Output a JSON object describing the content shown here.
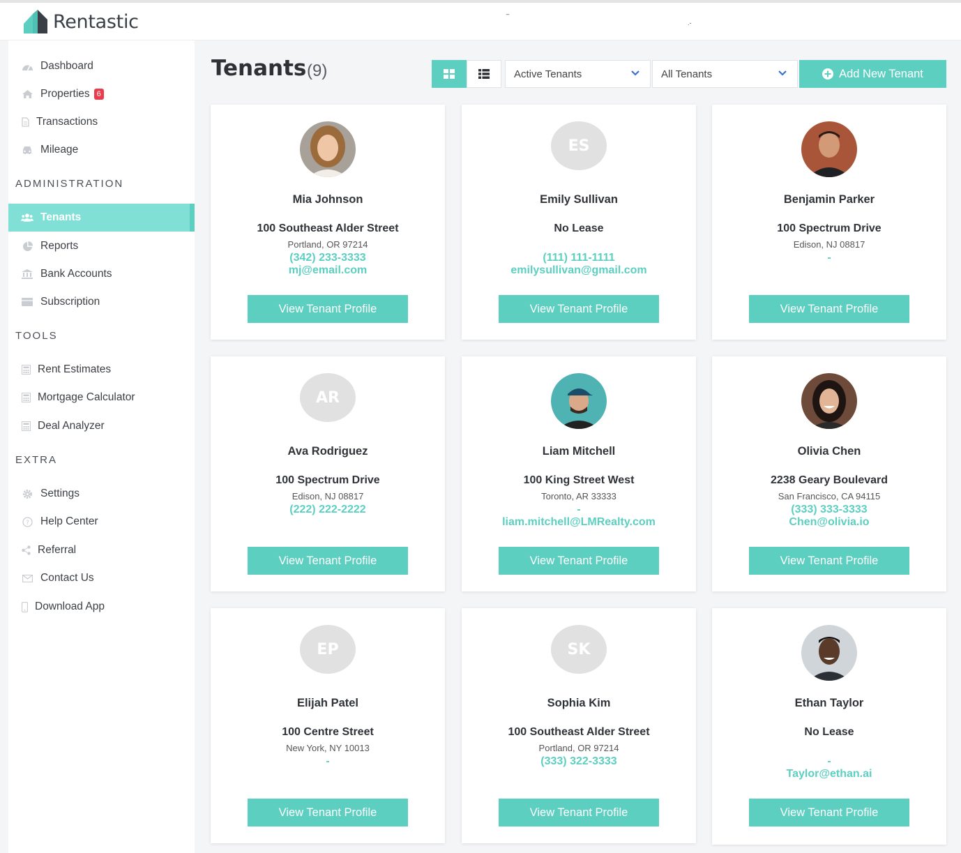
{
  "app": {
    "name": "Rentastic"
  },
  "sidebar": {
    "items": [
      {
        "label": "Dashboard",
        "icon": "dashboard-icon"
      },
      {
        "label": "Properties",
        "icon": "home-icon",
        "badge": "6"
      },
      {
        "label": "Transactions",
        "icon": "document-icon"
      },
      {
        "label": "Mileage",
        "icon": "car-icon"
      },
      {
        "label": "Tenants",
        "icon": "users-icon",
        "active": true
      },
      {
        "label": "Reports",
        "icon": "pie-chart-icon"
      },
      {
        "label": "Bank Accounts",
        "icon": "bank-icon"
      },
      {
        "label": "Subscription",
        "icon": "card-icon"
      },
      {
        "label": "Rent Estimates",
        "icon": "calculator-icon"
      },
      {
        "label": "Mortgage Calculator",
        "icon": "calculator-icon"
      },
      {
        "label": "Deal Analyzer",
        "icon": "calculator-icon"
      },
      {
        "label": "Settings",
        "icon": "gear-icon"
      },
      {
        "label": "Help Center",
        "icon": "help-icon"
      },
      {
        "label": "Referral",
        "icon": "share-icon"
      },
      {
        "label": "Contact Us",
        "icon": "envelope-icon"
      },
      {
        "label": "Download App",
        "icon": "phone-icon"
      }
    ],
    "sections": {
      "administration": "ADMINISTRATION",
      "tools": "TOOLS",
      "extra": "EXTRA"
    }
  },
  "header": {
    "title": "Tenants",
    "count": "(9)",
    "filter_status": "Active Tenants",
    "filter_group": "All Tenants",
    "add_label": "Add New Tenant"
  },
  "colors": {
    "accent": "#5ccfc1",
    "active_nav": "#81e0d5",
    "badge": "#ea3c4c"
  },
  "tenants": [
    {
      "name": "Mia Johnson",
      "street": "100 Southeast Alder Street",
      "city": "Portland, OR 97214",
      "phone": "(342) 233-3333",
      "email": "mj@email.com",
      "button": "View Tenant Profile"
    },
    {
      "name": "Emily Sullivan",
      "initials": "ES",
      "street": "No Lease",
      "city": "",
      "phone": "(111) 111-1111",
      "email": "emilysullivan@gmail.com",
      "button": "View Tenant Profile"
    },
    {
      "name": "Benjamin Parker",
      "street": "100 Spectrum Drive",
      "city": "Edison, NJ 08817",
      "phone": "-",
      "email": "",
      "button": "View Tenant Profile"
    },
    {
      "name": "Ava Rodriguez",
      "initials": "AR",
      "street": "100 Spectrum Drive",
      "city": "Edison, NJ 08817",
      "phone": "(222) 222-2222",
      "email": "",
      "button": "View Tenant Profile"
    },
    {
      "name": "Liam Mitchell",
      "street": "100 King Street West",
      "city": "Toronto, AR 33333",
      "phone": "-",
      "email": "liam.mitchell@LMRealty.com",
      "button": "View Tenant Profile"
    },
    {
      "name": "Olivia Chen",
      "street": "2238 Geary Boulevard",
      "city": "San Francisco, CA 94115",
      "phone": "(333) 333-3333",
      "email": "Chen@olivia.io",
      "button": "View Tenant Profile"
    },
    {
      "name": "Elijah Patel",
      "initials": "EP",
      "street": "100 Centre Street",
      "city": "New York, NY 10013",
      "phone": "-",
      "email": "",
      "button": "View Tenant Profile"
    },
    {
      "name": "Sophia Kim",
      "initials": "SK",
      "street": "100 Southeast Alder Street",
      "city": "Portland, OR 97214",
      "phone": "(333) 322-3333",
      "email": "",
      "button": "View Tenant Profile"
    },
    {
      "name": "Ethan Taylor",
      "street": "No Lease",
      "city": "",
      "phone": "-",
      "email": "Taylor@ethan.ai",
      "button": "View Tenant Profile"
    }
  ]
}
